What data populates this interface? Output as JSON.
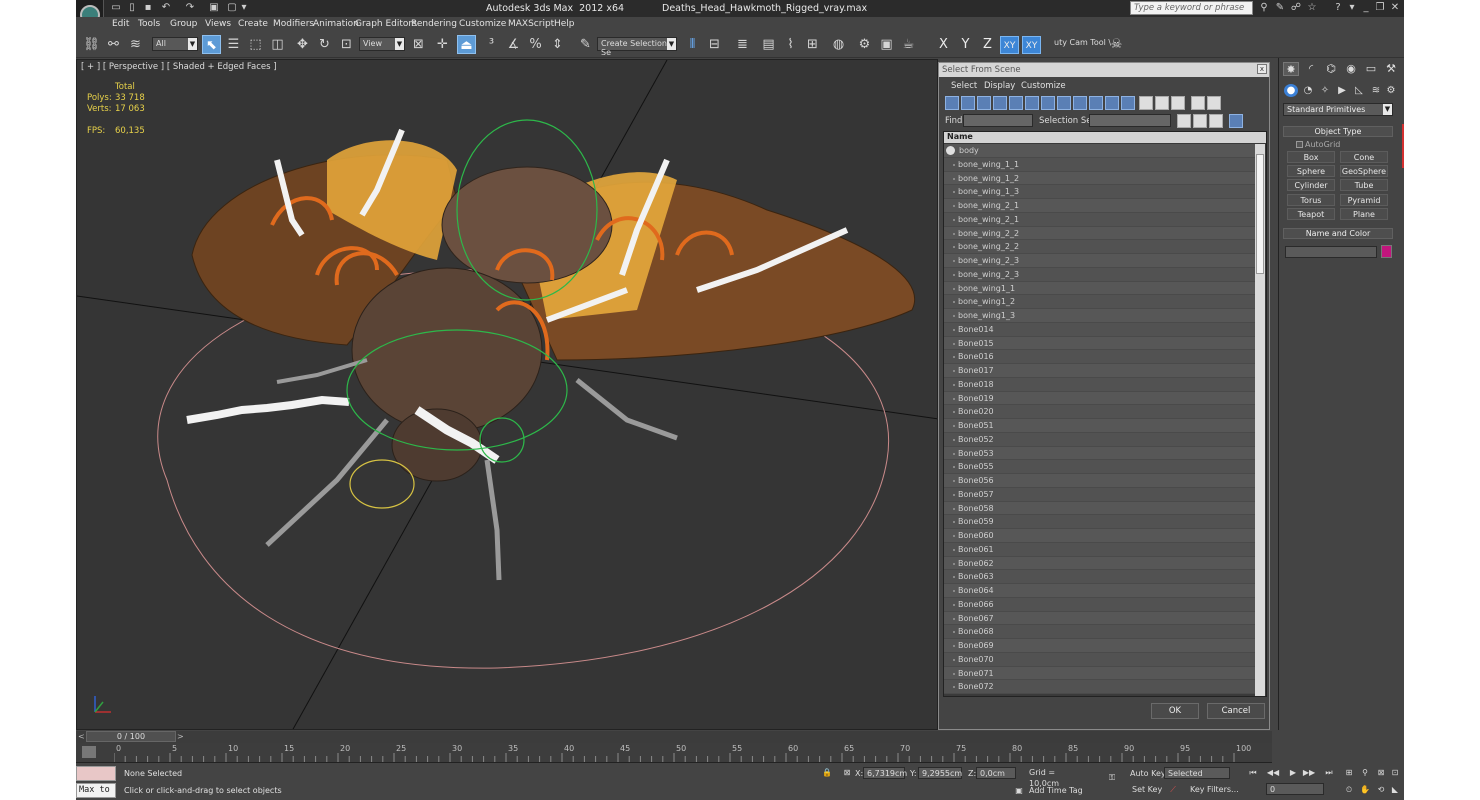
{
  "window": {
    "app_title": "Autodesk 3ds Max  2012 x64",
    "file_name": "Deaths_Head_Hawkmoth_Rigged_vray.max",
    "search_placeholder": "Type a keyword or phrase"
  },
  "menu": [
    "Edit",
    "Tools",
    "Group",
    "Views",
    "Create",
    "Modifiers",
    "Animation",
    "Graph Editors",
    "Rendering",
    "Customize",
    "MAXScript",
    "Help"
  ],
  "toolbar": {
    "selection_filter": "All",
    "reference_coord": "View",
    "named_selection": "Create Selection Se",
    "axis_x": "X",
    "axis_y": "Y",
    "axis_z": "Z",
    "axis_xy": "XY",
    "axis_xy2": "XY",
    "cam_tool": "uty Cam Tool \\"
  },
  "viewport": {
    "label": "[ + ] [ Perspective ] [ Shaded + Edged Faces ]",
    "stats_header": "Total",
    "polys_label": "Polys:",
    "polys_value": "33 718",
    "verts_label": "Verts:",
    "verts_value": "17 063",
    "fps_label": "FPS:",
    "fps_value": "60,135"
  },
  "dialog": {
    "title": "Select From Scene",
    "close": "x",
    "menu": [
      "Select",
      "Display",
      "Customize"
    ],
    "find_label": "Find:",
    "selset_label": "Selection Set:",
    "column_name": "Name",
    "items": [
      "body",
      "bone_wing_1_1",
      "bone_wing_1_2",
      "bone_wing_1_3",
      "bone_wing_2_1",
      "bone_wing_2_1",
      "bone_wing_2_2",
      "bone_wing_2_2",
      "bone_wing_2_3",
      "bone_wing_2_3",
      "bone_wing1_1",
      "bone_wing1_2",
      "bone_wing1_3",
      "Bone014",
      "Bone015",
      "Bone016",
      "Bone017",
      "Bone018",
      "Bone019",
      "Bone020",
      "Bone051",
      "Bone052",
      "Bone053",
      "Bone055",
      "Bone056",
      "Bone057",
      "Bone058",
      "Bone059",
      "Bone060",
      "Bone061",
      "Bone062",
      "Bone063",
      "Bone064",
      "Bone066",
      "Bone067",
      "Bone068",
      "Bone069",
      "Bone070",
      "Bone071",
      "Bone072"
    ],
    "ok": "OK",
    "cancel": "Cancel"
  },
  "command_panel": {
    "category": "Standard Primitives",
    "object_type_header": "Object Type",
    "autogrid": "AutoGrid",
    "primitives": [
      "Box",
      "Cone",
      "Sphere",
      "GeoSphere",
      "Cylinder",
      "Tube",
      "Torus",
      "Pyramid",
      "Teapot",
      "Plane"
    ],
    "name_color_header": "Name and Color",
    "color": "#c2157d"
  },
  "timeline": {
    "slider_label": "0 / 100",
    "prev": "<",
    "next": ">",
    "ticks": [
      "0",
      "5",
      "10",
      "15",
      "20",
      "25",
      "30",
      "35",
      "40",
      "45",
      "50",
      "55",
      "60",
      "65",
      "70",
      "75",
      "80",
      "85",
      "90",
      "95",
      "100"
    ]
  },
  "status": {
    "maxscript_label": "Max to",
    "selection": "None Selected",
    "prompt": "Click or click-and-drag to select objects",
    "x_label": "X:",
    "x_value": "6,7319cm",
    "y_label": "Y:",
    "y_value": "9,2955cm",
    "z_label": "Z:",
    "z_value": "0,0cm",
    "grid": "Grid = 10,0cm",
    "add_time_tag": "Add Time Tag",
    "auto_key": "Auto Key",
    "set_key": "Set Key",
    "key_mode": "Selected",
    "key_filters": "Key Filters...",
    "frame": "0"
  }
}
